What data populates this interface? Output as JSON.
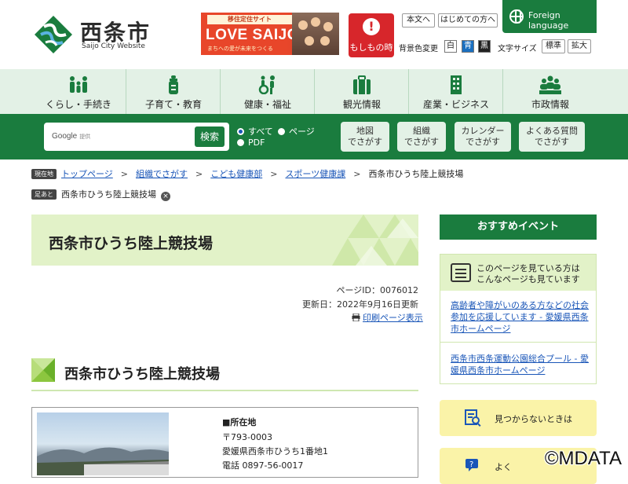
{
  "header": {
    "logo_jp": "西条市",
    "logo_en": "Saijo City Website",
    "banner": {
      "top": "移住定住サイト",
      "main": "LOVE SAIJO",
      "sub": "まちへの愛が未来をつくる"
    },
    "emergency": {
      "icon": "!",
      "label": "もしもの時"
    },
    "text_version": "本文へ",
    "first_time": "はじめての方へ",
    "bg_color_label": "背景色変更",
    "bg_colors": [
      {
        "label": "白",
        "bg": "#ffffff",
        "fg": "#222222"
      },
      {
        "label": "青",
        "bg": "#1a6fc0",
        "fg": "#ffffff"
      },
      {
        "label": "黒",
        "bg": "#222222",
        "fg": "#ffffff"
      }
    ],
    "font_size_label": "文字サイズ",
    "font_standard": "標準",
    "font_large": "拡大",
    "foreign_language": "Foreign language"
  },
  "categories": [
    {
      "label": "くらし・手続き",
      "icon": "family-icon"
    },
    {
      "label": "子育て・教育",
      "icon": "baby-bottle-icon"
    },
    {
      "label": "健康・福祉",
      "icon": "wheelchair-icon"
    },
    {
      "label": "観光情報",
      "icon": "suitcase-icon"
    },
    {
      "label": "産業・ビジネス",
      "icon": "building-icon"
    },
    {
      "label": "市政情報",
      "icon": "people-group-icon"
    }
  ],
  "search": {
    "google_label": "Google",
    "provided_label": "提供",
    "button": "検索",
    "option_all": "すべて",
    "option_page": "ページ",
    "option_pdf": "PDF",
    "quick": [
      {
        "line1": "地図",
        "line2": "でさがす"
      },
      {
        "line1": "組織",
        "line2": "でさがす"
      },
      {
        "line1": "カレンダー",
        "line2": "でさがす"
      },
      {
        "line1": "よくある質問",
        "line2": "でさがす"
      }
    ]
  },
  "breadcrumb": {
    "current_tag": "現在地",
    "items": [
      "トップページ",
      "組織でさがす",
      "こども健康部",
      "スポーツ健康課"
    ],
    "current": "西条市ひうち陸上競技場",
    "history_tag": "足あと",
    "history_item": "西条市ひうち陸上競技場",
    "history_close": "×"
  },
  "main": {
    "title": "西条市ひうち陸上競技場",
    "page_id": "ページID：0076012",
    "updated": "更新日：2022年9月16日更新",
    "print": "印刷ページ表示",
    "section_title": "西条市ひうち陸上競技場",
    "location_heading": "■所在地",
    "postal": "〒793-0003",
    "address": "愛媛県西条市ひうち1番地1",
    "phone": "電話 0897-56-0017"
  },
  "sidebar": {
    "events_heading": "おすすめイベント",
    "related_heading_1": "このページを見ている方は",
    "related_heading_2": "こんなページも見ています",
    "related_links": [
      "高齢者や障がいのある方などの社会参加を応援しています - 愛媛県西条市ホームページ",
      "西条市西条運動公園総合プール - 愛媛県西条市ホームページ"
    ],
    "not_found": "見つからないときは",
    "partial": "よく"
  },
  "watermark": "©MDATA",
  "colors": {
    "green": "#1a7c3e",
    "light_green": "#e3f1e6",
    "lime": "#e2f2c8",
    "yellow": "#faf3a8",
    "red": "#d7262b",
    "link": "#1a56b8"
  }
}
